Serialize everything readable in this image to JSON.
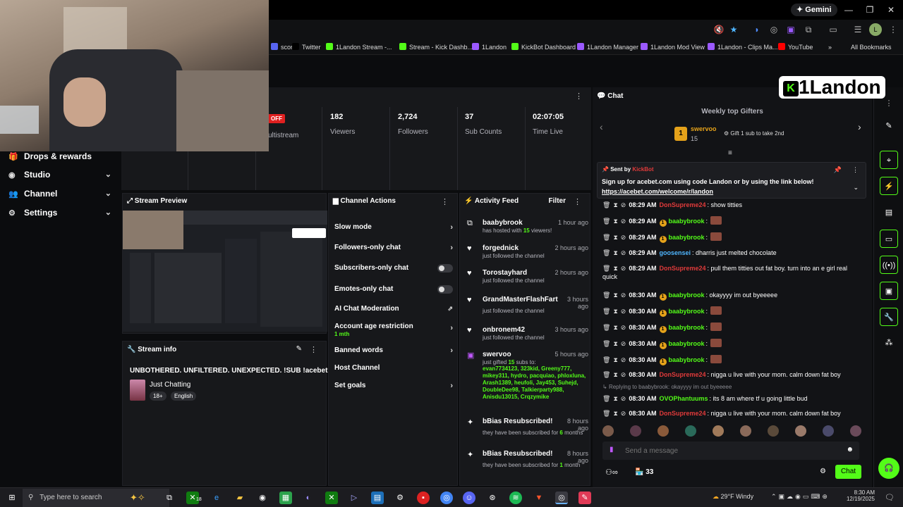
{
  "browser": {
    "gemini_label": "Gemini",
    "bookmarks": [
      {
        "label": "scord",
        "color": "#5865f2"
      },
      {
        "label": "Twitter",
        "color": "#000000"
      },
      {
        "label": "1Landon Stream -...",
        "color": "#53fc18"
      },
      {
        "label": "Stream - Kick Dashb...",
        "color": "#53fc18"
      },
      {
        "label": "1Landon",
        "color": "#9b59ff"
      },
      {
        "label": "KickBot Dashboard",
        "color": "#53fc18"
      },
      {
        "label": "1Landon Manager",
        "color": "#9b59ff"
      },
      {
        "label": "1Landon Mod View",
        "color": "#9b59ff"
      },
      {
        "label": "1Landon - Clips Ma...",
        "color": "#9b59ff"
      },
      {
        "label": "YouTube",
        "color": "#ff0000"
      },
      {
        "label": "»",
        "color": ""
      },
      {
        "label": "All Bookmarks",
        "color": ""
      }
    ]
  },
  "overlay": {
    "logo_text": "1Landon"
  },
  "sidebar": {
    "items": [
      {
        "label": "Drops & rewards",
        "icon": "gift-icon"
      },
      {
        "label": "Studio",
        "icon": "studio-icon"
      },
      {
        "label": "Channel",
        "icon": "people-icon"
      },
      {
        "label": "Settings",
        "icon": "gear-icon"
      }
    ]
  },
  "stats": {
    "off_badge": "OFF",
    "multistream_label": "ultistream",
    "items": [
      {
        "value": "182",
        "label": "Viewers"
      },
      {
        "value": "2,724",
        "label": "Followers"
      },
      {
        "value": "37",
        "label": "Sub Counts"
      },
      {
        "value": "02:07:05",
        "label": "Time Live"
      }
    ]
  },
  "stream_preview": {
    "title": "Stream Preview"
  },
  "stream_info": {
    "title": "Stream info",
    "stream_title": "UNBOTHERED. UNFILTERED. UNEXPECTED. !SUB !acebet",
    "category": "Just Chatting",
    "tags": [
      "18+",
      "English"
    ]
  },
  "channel_actions": {
    "title": "Channel Actions",
    "items": [
      {
        "label": "Slow mode",
        "control": "chevron"
      },
      {
        "label": "Followers-only chat",
        "control": "chevron"
      },
      {
        "label": "Subscribers-only chat",
        "control": "toggle"
      },
      {
        "label": "Emotes-only chat",
        "control": "toggle"
      },
      {
        "label": "AI Chat Moderation",
        "control": "external"
      },
      {
        "label": "Account age restriction",
        "sub": "1 mth",
        "control": "chevron"
      },
      {
        "label": "Banned words",
        "control": "chevron"
      },
      {
        "label": "Host Channel",
        "control": "none"
      },
      {
        "label": "Set goals",
        "control": "chevron"
      }
    ]
  },
  "activity_feed": {
    "title": "Activity Feed",
    "filter_label": "Filter",
    "items": [
      {
        "name": "baabybrook",
        "time": "1 hour ago",
        "text_pre": "has hosted with ",
        "highlight": "15",
        "text_post": " viewers!",
        "icon": "host-icon"
      },
      {
        "name": "forgednick",
        "time": "2 hours ago",
        "text_pre": "just followed the channel",
        "icon": "heart-icon"
      },
      {
        "name": "Torostayhard",
        "time": "2 hours ago",
        "text_pre": "just followed the channel",
        "icon": "heart-icon"
      },
      {
        "name": "GrandMasterFlashFart",
        "time": "3 hours ago",
        "text_pre": "just followed the channel",
        "icon": "heart-icon"
      },
      {
        "name": "onbronem42",
        "time": "3 hours ago",
        "text_pre": "just followed the channel",
        "icon": "heart-icon"
      },
      {
        "name": "swervoo",
        "time": "5 hours ago",
        "text_pre": "just gifted ",
        "highlight": "15",
        "text_post": " subs to:",
        "recipients": "evan7734123, 323kid, Greeny777, mikey311, hydro, pacquiao, phloxluna, Arash1389, heufoli, Jay453, Suhejd, DoubleDee98, Talkierparty988, Anisdu13015, Crqzymike",
        "icon": "gift-icon"
      },
      {
        "name": "bBias Resubscribed!",
        "time": "8 hours ago",
        "text_pre": "they have been subscribed for ",
        "highlight": "6",
        "text_post": " months",
        "icon": "sparkle-icon"
      },
      {
        "name": "bBias Resubscribed!",
        "time": "8 hours ago",
        "text_pre": "they have been subscribed for ",
        "highlight": "1",
        "text_post": " month",
        "icon": "sparkle-icon"
      }
    ]
  },
  "chat": {
    "title": "Chat",
    "gifters_title": "Weekly top Gifters",
    "top_gifter": {
      "name": "swervoo",
      "amount": "15",
      "rank": "1"
    },
    "gift_cta": "Gift 1 sub to take 2nd",
    "pinned": {
      "sent_by": "Sent by",
      "sender": "KickBot",
      "text": "Sign up for acebet.com using code Landon or by using the link below!",
      "link": "https://acebet.com/welcome/r/landon"
    },
    "messages": [
      {
        "time": "08:29 AM",
        "user": "DonSupreme24",
        "color": "red",
        "text": ": show titties"
      },
      {
        "time": "08:29 AM",
        "user": "baabybrook",
        "color": "green",
        "badge": "1",
        "text": ":"
      },
      {
        "time": "08:29 AM",
        "user": "baabybrook",
        "color": "green",
        "badge": "1",
        "text": ":"
      },
      {
        "time": "08:29 AM",
        "user": "goosensei",
        "color": "blue",
        "text": ": dharris just melted chocolate"
      },
      {
        "time": "08:29 AM",
        "user": "DonSupreme24",
        "color": "red",
        "text": ": pull them titties out fat boy. turn into an e girl real",
        "text2": "quick"
      },
      {
        "time": "08:30 AM",
        "user": "baabybrook",
        "color": "green",
        "badge": "1",
        "text": ": okayyyy im out byeeeee"
      },
      {
        "time": "08:30 AM",
        "user": "baabybrook",
        "color": "green",
        "badge": "1",
        "text": ":"
      },
      {
        "time": "08:30 AM",
        "user": "baabybrook",
        "color": "green",
        "badge": "1",
        "text": ":"
      },
      {
        "time": "08:30 AM",
        "user": "baabybrook",
        "color": "green",
        "badge": "1",
        "text": ":"
      },
      {
        "time": "08:30 AM",
        "user": "baabybrook",
        "color": "green",
        "badge": "1",
        "text": ":"
      },
      {
        "time": "08:30 AM",
        "user": "DonSupreme24",
        "color": "red",
        "text": ": nigga u live with your mom. calm down fat boy"
      },
      {
        "reply": "Replying to baabybrook: okayyyy im out byeeeee",
        "time": "08:30 AM",
        "user": "OVOPhantuums",
        "color": "green",
        "text": ": its 8 am where tf u going little bud"
      },
      {
        "time": "08:30 AM",
        "user": "DonSupreme24",
        "color": "red",
        "text": ": nigga u live with your mom. calm down fat boy"
      }
    ],
    "input_placeholder": "Send a message",
    "viewer_count": "33",
    "send_label": "Chat"
  },
  "taskbar": {
    "search_placeholder": "Type here to search",
    "weather": "29°F  Windy",
    "time": "8:30 AM",
    "date": "12/19/2025",
    "badge": "18"
  }
}
